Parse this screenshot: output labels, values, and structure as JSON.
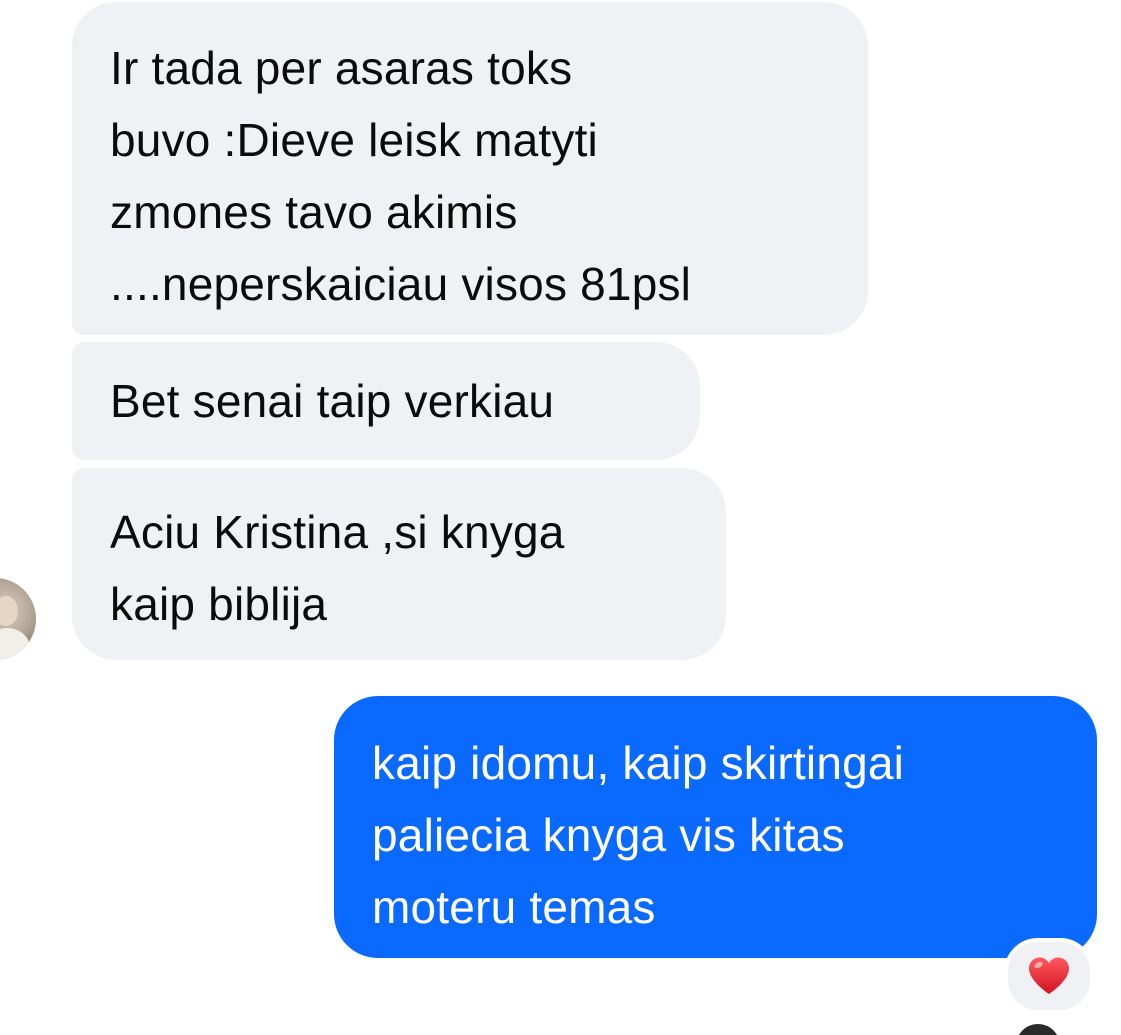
{
  "conversation": {
    "messages": [
      {
        "direction": "incoming",
        "lines": [
          "Ir tada per asaras toks",
          "buvo :Dieve leisk matyti",
          "zmones tavo akimis",
          "....neperskaiciau visos 81psl"
        ]
      },
      {
        "direction": "incoming",
        "lines": [
          "Bet senai taip verkiau"
        ]
      },
      {
        "direction": "incoming",
        "lines": [
          "Aciu Kristina ,si knyga",
          "kaip biblija"
        ]
      },
      {
        "direction": "outgoing",
        "lines": [
          "kaip idomu, kaip skirtingai",
          "paliecia knyga vis kitas",
          "moteru temas"
        ],
        "reaction": "heart-icon"
      }
    ]
  },
  "colors": {
    "incoming_bubble": "#f0f1f5",
    "outgoing_bubble": "#0a69ff",
    "incoming_text": "#0b0b0b",
    "outgoing_text": "#ffffff",
    "reaction_heart": "#e0202e"
  }
}
